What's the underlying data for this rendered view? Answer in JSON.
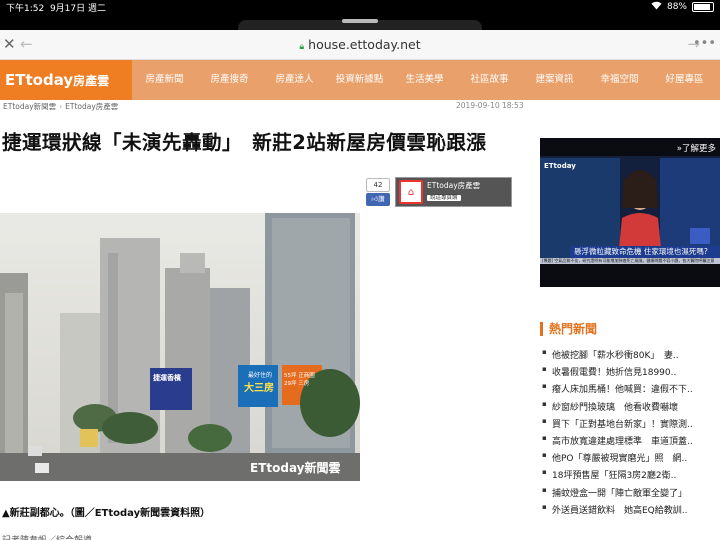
{
  "status_bar": {
    "time": "下午1:52",
    "date": "9月17日 週二",
    "battery": "88%",
    "battery_level": 0.88
  },
  "browser": {
    "url": "house.ettoday.net"
  },
  "site": {
    "logo_prefix": "ETtoday",
    "logo_suffix": "房產雲",
    "nav": [
      "房產新聞",
      "房產搜奇",
      "房產達人",
      "投資新據點",
      "生活美學",
      "社區故事",
      "建案資訊",
      "幸福空間",
      "好屋專區"
    ]
  },
  "breadcrumb": [
    "ETtoday新聞雲",
    "ETtoday房產雲"
  ],
  "article": {
    "date": "2019-09-10 18:53",
    "headline": "捷運環狀線「未演先轟動」　新莊2站新屋房價雲恥跟漲",
    "share_count": "42",
    "like_label": "讚",
    "fanpage_name": "ETtoday房產雲",
    "fanpage_button": "說這專頁讚",
    "photo_watermark": "ETtoday新聞雲",
    "photo_signs": [
      "捷運香檳",
      "最好住的",
      "大三房",
      "55坪 正商圈",
      "29坪 三房"
    ],
    "caption": "▲新莊副都心。（圖／ETtoday新聞雲資料照）",
    "trailing_text": "記者陳韋帆／綜合報導"
  },
  "video": {
    "more_label": "了解更多",
    "brand": "ETtoday",
    "ticker": "懸浮微粒藏致命危機 住家環境也濕死嗎?",
    "crawl": "[專題] 空氣品質不佳，研究證明有可能增加肺癌死亡風險。健康問題不容小覷，各大醫院呼籲注意"
  },
  "hot_news": {
    "title": "熱門新聞",
    "items": [
      "他被挖腳「薪水秒衝80K」　妻..",
      "收暑假電費！她折信見18990..",
      "癈人床加馬桶！他喊買：違假不下..",
      "紗窗紗門換玻璃　他看收費嚇壞",
      "買下「正對基地台新家」！實際測..",
      "高市放寬違建處理標準　車道頂蓋..",
      "他PO「尊嚴被現實磨光」照　網..",
      "18坪預售屋「狂隔3房2廳2衛..",
      "捕蚊燈盒一開「陣亡敵軍全變了」",
      "外送員送錯飲料　她高EQ給教訓.."
    ]
  }
}
